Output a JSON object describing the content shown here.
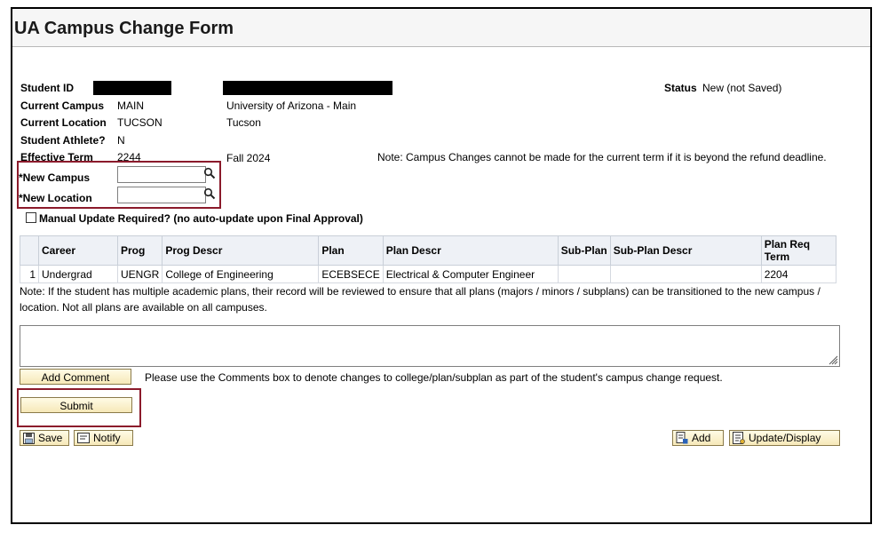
{
  "window": {
    "title": "UA Campus Change Form"
  },
  "fields": {
    "student_id_label": "Student ID",
    "status_label": "Status",
    "status_value": "New (not Saved)",
    "current_campus_label": "Current Campus",
    "current_campus_code": "MAIN",
    "current_campus_desc": "University of Arizona - Main",
    "current_location_label": "Current Location",
    "current_location_code": "TUCSON",
    "current_location_desc": "Tucson",
    "athlete_label": "Student Athlete?",
    "athlete_value": "N",
    "effective_term_label": "Effective Term",
    "effective_term_code": "2244",
    "effective_term_desc": "Fall 2024",
    "term_note": "Note: Campus Changes cannot be made for the current term if it is beyond the refund deadline.",
    "new_campus_label": "*New Campus",
    "new_campus_value": "",
    "new_location_label": "*New Location",
    "new_location_value": "",
    "manual_update_label": "Manual Update Required? (no auto-update upon Final Approval)"
  },
  "plans_table": {
    "columns": [
      "",
      "Career",
      "Prog",
      "Prog Descr",
      "Plan",
      "Plan Descr",
      "Sub-Plan",
      "Sub-Plan Descr",
      "Plan Req Term"
    ],
    "rows": [
      [
        "1",
        "Undergrad",
        "UENGR",
        "College of Engineering",
        "ECEBSECE",
        "Electrical & Computer Engineer",
        "",
        "",
        "2204"
      ]
    ]
  },
  "plans_note_line1": "Note: If the student has multiple academic plans, their record will be reviewed to ensure that all plans (majors / minors / subplans) can be transitioned to the new campus /",
  "plans_note_line2": "location. Not all plans are available on all campuses.",
  "comments": {
    "value": "",
    "add_comment_label": "Add Comment",
    "hint": "Please use the Comments box to denote changes to college/plan/subplan as part of the student's campus change request."
  },
  "actions": {
    "submit_label": "Submit",
    "save_label": "Save",
    "notify_label": "Notify",
    "add_label": "Add",
    "update_display_label": "Update/Display"
  },
  "icons": [
    "lookup-icon",
    "save-icon",
    "notify-icon",
    "add-icon",
    "update-display-icon",
    "resize-grip-icon"
  ],
  "colors": {
    "highlight_border": "#8b1a2b",
    "button_bg": "#f6e8b8",
    "header_bg": "#eef1f6"
  }
}
